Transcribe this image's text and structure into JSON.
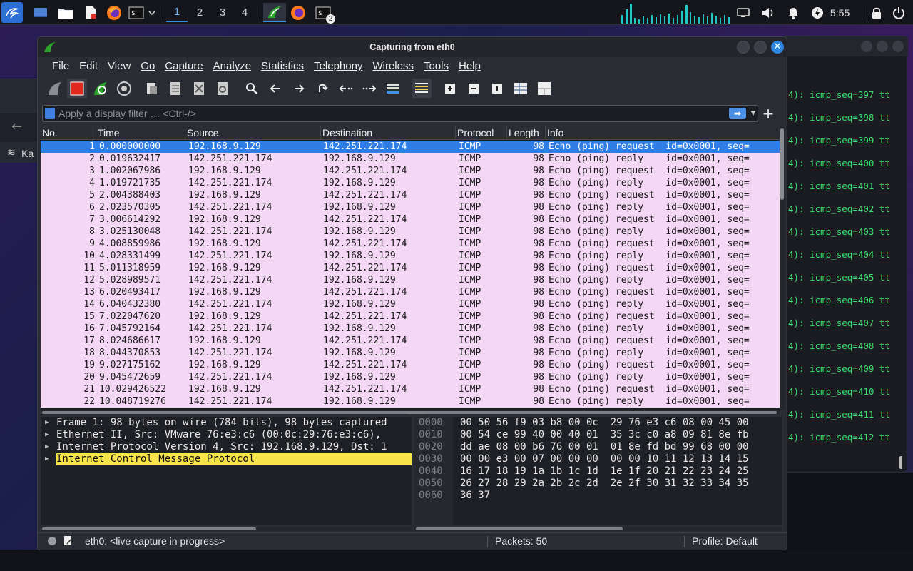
{
  "panel": {
    "workspaces": [
      "1",
      "2",
      "3",
      "4"
    ],
    "clock": "5:55",
    "terminal_badge": "2"
  },
  "background": {
    "left_window_text": "Ka",
    "terminal_lines": [
      "4): icmp_seq=397 tt",
      "4): icmp_seq=398 tt",
      "4): icmp_seq=399 tt",
      "4): icmp_seq=400 tt",
      "4): icmp_seq=401 tt",
      "4): icmp_seq=402 tt",
      "4): icmp_seq=403 tt",
      "4): icmp_seq=404 tt",
      "4): icmp_seq=405 tt",
      "4): icmp_seq=406 tt",
      "4): icmp_seq=407 tt",
      "4): icmp_seq=408 tt",
      "4): icmp_seq=409 tt",
      "4): icmp_seq=410 tt",
      "4): icmp_seq=411 tt",
      "4): icmp_seq=412 tt"
    ]
  },
  "window": {
    "title": "Capturing from eth0",
    "close_glyph": "✕"
  },
  "menu": {
    "items": [
      "File",
      "Edit",
      "View",
      "Go",
      "Capture",
      "Analyze",
      "Statistics",
      "Telephony",
      "Wireless",
      "Tools",
      "Help"
    ]
  },
  "filter": {
    "placeholder": "Apply a display filter … <Ctrl-/>",
    "value": ""
  },
  "packet_list": {
    "columns": [
      "No.",
      "Time",
      "Source",
      "Destination",
      "Protocol",
      "Length",
      "Info"
    ],
    "rows": [
      {
        "no": "1",
        "time": "0.000000000",
        "src": "192.168.9.129",
        "dst": "142.251.221.174",
        "proto": "ICMP",
        "len": "98",
        "info": "Echo (ping) request  id=0x0001, seq="
      },
      {
        "no": "2",
        "time": "0.019632417",
        "src": "142.251.221.174",
        "dst": "192.168.9.129",
        "proto": "ICMP",
        "len": "98",
        "info": "Echo (ping) reply    id=0x0001, seq="
      },
      {
        "no": "3",
        "time": "1.002067986",
        "src": "192.168.9.129",
        "dst": "142.251.221.174",
        "proto": "ICMP",
        "len": "98",
        "info": "Echo (ping) request  id=0x0001, seq="
      },
      {
        "no": "4",
        "time": "1.019721735",
        "src": "142.251.221.174",
        "dst": "192.168.9.129",
        "proto": "ICMP",
        "len": "98",
        "info": "Echo (ping) reply    id=0x0001, seq="
      },
      {
        "no": "5",
        "time": "2.004388403",
        "src": "192.168.9.129",
        "dst": "142.251.221.174",
        "proto": "ICMP",
        "len": "98",
        "info": "Echo (ping) request  id=0x0001, seq="
      },
      {
        "no": "6",
        "time": "2.023570305",
        "src": "142.251.221.174",
        "dst": "192.168.9.129",
        "proto": "ICMP",
        "len": "98",
        "info": "Echo (ping) reply    id=0x0001, seq="
      },
      {
        "no": "7",
        "time": "3.006614292",
        "src": "192.168.9.129",
        "dst": "142.251.221.174",
        "proto": "ICMP",
        "len": "98",
        "info": "Echo (ping) request  id=0x0001, seq="
      },
      {
        "no": "8",
        "time": "3.025130048",
        "src": "142.251.221.174",
        "dst": "192.168.9.129",
        "proto": "ICMP",
        "len": "98",
        "info": "Echo (ping) reply    id=0x0001, seq="
      },
      {
        "no": "9",
        "time": "4.008859986",
        "src": "192.168.9.129",
        "dst": "142.251.221.174",
        "proto": "ICMP",
        "len": "98",
        "info": "Echo (ping) request  id=0x0001, seq="
      },
      {
        "no": "10",
        "time": "4.028331499",
        "src": "142.251.221.174",
        "dst": "192.168.9.129",
        "proto": "ICMP",
        "len": "98",
        "info": "Echo (ping) reply    id=0x0001, seq="
      },
      {
        "no": "11",
        "time": "5.011318959",
        "src": "192.168.9.129",
        "dst": "142.251.221.174",
        "proto": "ICMP",
        "len": "98",
        "info": "Echo (ping) request  id=0x0001, seq="
      },
      {
        "no": "12",
        "time": "5.028989571",
        "src": "142.251.221.174",
        "dst": "192.168.9.129",
        "proto": "ICMP",
        "len": "98",
        "info": "Echo (ping) reply    id=0x0001, seq="
      },
      {
        "no": "13",
        "time": "6.020493417",
        "src": "192.168.9.129",
        "dst": "142.251.221.174",
        "proto": "ICMP",
        "len": "98",
        "info": "Echo (ping) request  id=0x0001, seq="
      },
      {
        "no": "14",
        "time": "6.040432380",
        "src": "142.251.221.174",
        "dst": "192.168.9.129",
        "proto": "ICMP",
        "len": "98",
        "info": "Echo (ping) reply    id=0x0001, seq="
      },
      {
        "no": "15",
        "time": "7.022047620",
        "src": "192.168.9.129",
        "dst": "142.251.221.174",
        "proto": "ICMP",
        "len": "98",
        "info": "Echo (ping) request  id=0x0001, seq="
      },
      {
        "no": "16",
        "time": "7.045792164",
        "src": "142.251.221.174",
        "dst": "192.168.9.129",
        "proto": "ICMP",
        "len": "98",
        "info": "Echo (ping) reply    id=0x0001, seq="
      },
      {
        "no": "17",
        "time": "8.024686617",
        "src": "192.168.9.129",
        "dst": "142.251.221.174",
        "proto": "ICMP",
        "len": "98",
        "info": "Echo (ping) request  id=0x0001, seq="
      },
      {
        "no": "18",
        "time": "8.044370853",
        "src": "142.251.221.174",
        "dst": "192.168.9.129",
        "proto": "ICMP",
        "len": "98",
        "info": "Echo (ping) reply    id=0x0001, seq="
      },
      {
        "no": "19",
        "time": "9.027175162",
        "src": "192.168.9.129",
        "dst": "142.251.221.174",
        "proto": "ICMP",
        "len": "98",
        "info": "Echo (ping) request  id=0x0001, seq="
      },
      {
        "no": "20",
        "time": "9.045472659",
        "src": "142.251.221.174",
        "dst": "192.168.9.129",
        "proto": "ICMP",
        "len": "98",
        "info": "Echo (ping) reply    id=0x0001, seq="
      },
      {
        "no": "21",
        "time": "10.029426522",
        "src": "192.168.9.129",
        "dst": "142.251.221.174",
        "proto": "ICMP",
        "len": "98",
        "info": "Echo (ping) request  id=0x0001, seq="
      },
      {
        "no": "22",
        "time": "10.048719276",
        "src": "142.251.221.174",
        "dst": "192.168.9.129",
        "proto": "ICMP",
        "len": "98",
        "info": "Echo (ping) reply    id=0x0001, seq="
      }
    ]
  },
  "details": {
    "rows": [
      "Frame 1: 98 bytes on wire (784 bits), 98 bytes captured",
      "Ethernet II, Src: VMware_76:e3:c6 (00:0c:29:76:e3:c6),",
      "Internet Protocol Version 4, Src: 192.168.9.129, Dst: 1",
      "Internet Control Message Protocol"
    ]
  },
  "bytes": {
    "rows": [
      {
        "offset": "0000",
        "hex": "00 50 56 f9 03 b8 00 0c  29 76 e3 c6 08 00 45 00"
      },
      {
        "offset": "0010",
        "hex": "00 54 ce 99 40 00 40 01  35 3c c0 a8 09 81 8e fb"
      },
      {
        "offset": "0020",
        "hex": "dd ae 08 00 b6 76 00 01  01 8e fd bd 99 68 00 00"
      },
      {
        "offset": "0030",
        "hex": "00 00 e3 00 07 00 00 00  00 00 10 11 12 13 14 15"
      },
      {
        "offset": "0040",
        "hex": "16 17 18 19 1a 1b 1c 1d  1e 1f 20 21 22 23 24 25"
      },
      {
        "offset": "0050",
        "hex": "26 27 28 29 2a 2b 2c 2d  2e 2f 30 31 32 33 34 35"
      },
      {
        "offset": "0060",
        "hex": "36 37"
      }
    ]
  },
  "status": {
    "interface": "eth0: <live capture in progress>",
    "packets": "Packets: 50",
    "profile": "Profile: Default"
  },
  "colors": {
    "row_icmp": "#f4d7f4",
    "row_selected": "#2f7ee6",
    "highlight": "#f7e34a",
    "terminal_text": "#36e06b"
  }
}
